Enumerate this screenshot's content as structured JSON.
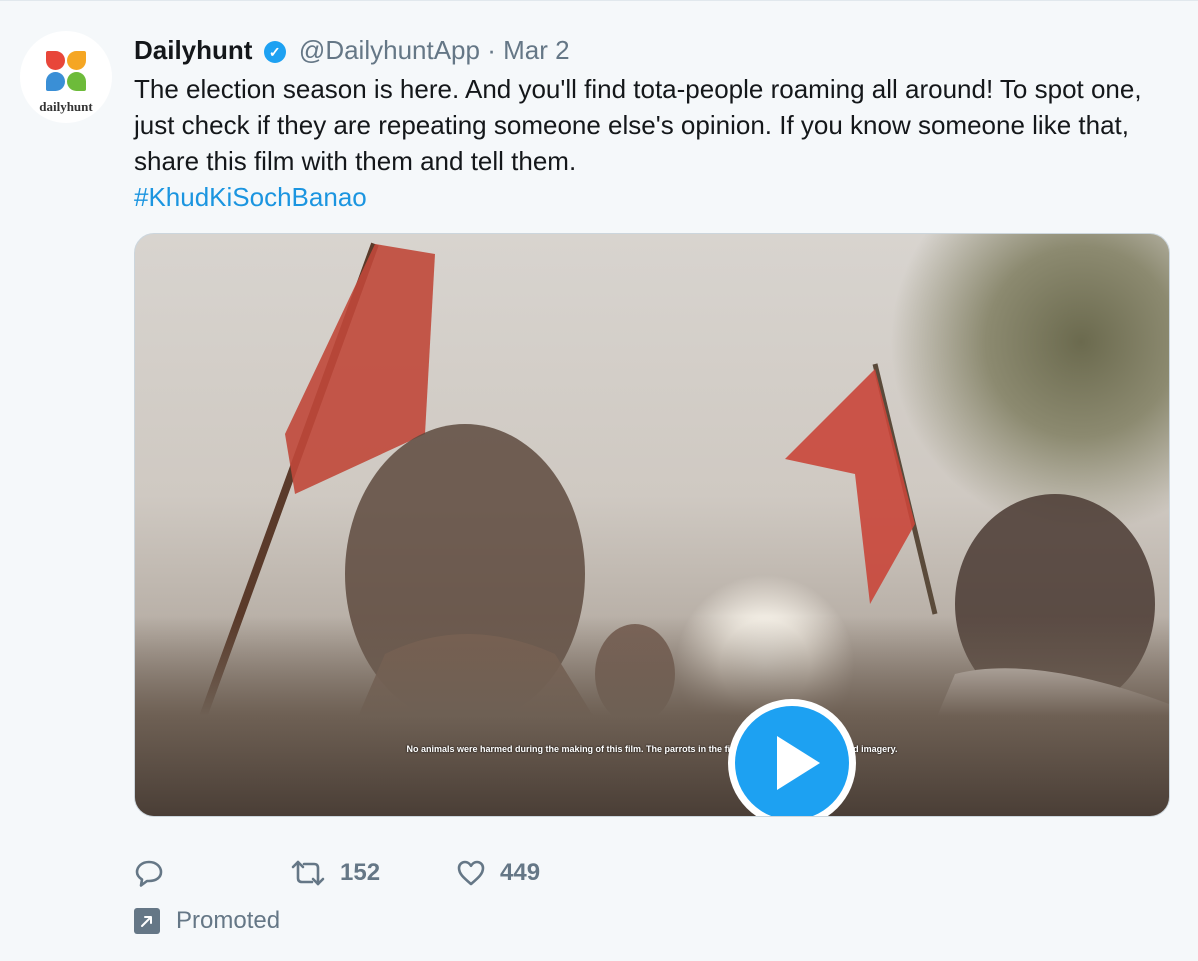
{
  "tweet": {
    "avatar_text": "dailyhunt",
    "name": "Dailyhunt",
    "handle": "@DailyhuntApp",
    "separator": "·",
    "date": "Mar 2",
    "text": "The election season is here. And you'll find tota-people roaming all around! To spot one, just check if they are repeating someone else's opinion. If you know someone like that, share this film with them and tell them.",
    "hashtag": "#KhudKiSochBanao",
    "media": {
      "subtitle": "No animals were harmed during the making of this film. The parrots in the film are all computer-generated imagery.",
      "play_icon": "play-icon"
    },
    "actions": {
      "reply_icon": "reply-icon",
      "retweet_icon": "retweet-icon",
      "retweet_count": "152",
      "like_icon": "heart-icon",
      "like_count": "449"
    },
    "promoted_label": "Promoted",
    "promoted_icon": "promoted-arrow-icon",
    "colors": {
      "link": "#1b95e0",
      "verified": "#1da1f2",
      "muted": "#657786",
      "background": "#f5f8fa"
    }
  }
}
